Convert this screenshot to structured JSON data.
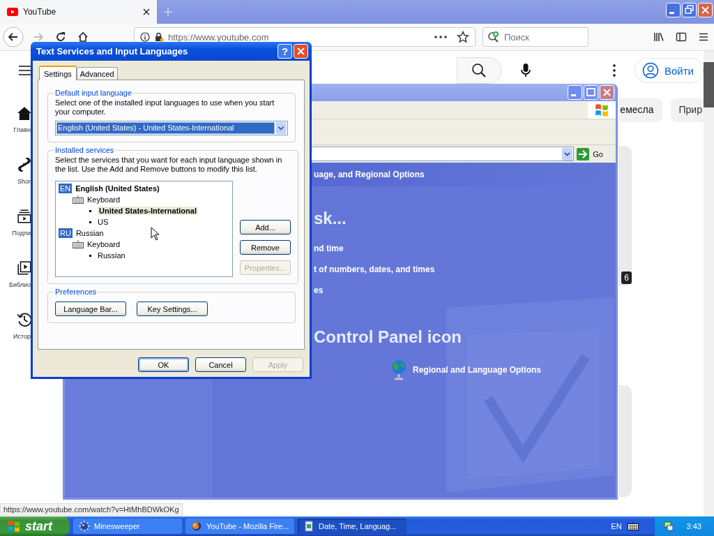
{
  "browser": {
    "tab": {
      "title": "YouTube"
    },
    "url": "https://www.youtube.com",
    "search": {
      "placeholder": "Поиск"
    },
    "status_url": "https://www.youtube.com/watch?v=HtMhBDWkOKg"
  },
  "youtube": {
    "sign_in": "Войти",
    "sidebar": [
      {
        "label": "Главн",
        "kind": "home"
      },
      {
        "label": "Shor",
        "kind": "shorts"
      },
      {
        "label": "Подпи",
        "kind": "subscriptions"
      },
      {
        "label": "Библио",
        "kind": "library"
      },
      {
        "label": "Истор",
        "kind": "history"
      }
    ],
    "chips": [
      {
        "label": "емесла"
      },
      {
        "label": "Прир"
      }
    ],
    "video_duration": "6"
  },
  "control_panel": {
    "go": "Go",
    "header": "uage, and Regional Options",
    "task_heading": "sk...",
    "tasks": [
      "nd time",
      "t of numbers, dates, and times",
      "es"
    ],
    "icon_heading": "Control Panel icon",
    "icons": [
      {
        "label": "Regional and Language Options"
      }
    ]
  },
  "dialog": {
    "title": "Text Services and Input Languages",
    "help": "?",
    "tabs": [
      {
        "label": "Settings",
        "selected": true
      },
      {
        "label": "Advanced",
        "selected": false
      }
    ],
    "default_group": {
      "title": "Default input language",
      "description": "Select one of the installed input languages to use when you start your computer.",
      "value": "English (United States) - United States-International"
    },
    "services_group": {
      "title": "Installed services",
      "description": "Select the services that you want for each input language shown in the list. Use the Add and Remove buttons to modify this list.",
      "languages": [
        {
          "code": "EN",
          "name": "English (United States)",
          "default": true,
          "children": [
            {
              "name": "Keyboard",
              "children": [
                {
                  "name": "United States-International",
                  "default": true,
                  "selected": true
                },
                {
                  "name": "US",
                  "default": false,
                  "selected": false
                }
              ]
            }
          ]
        },
        {
          "code": "RU",
          "name": "Russian",
          "default": false,
          "children": [
            {
              "name": "Keyboard",
              "children": [
                {
                  "name": "Russian",
                  "default": false,
                  "selected": false
                }
              ]
            }
          ]
        }
      ],
      "buttons": [
        {
          "label": "Add...",
          "disabled": false
        },
        {
          "label": "Remove",
          "disabled": false
        },
        {
          "label": "Properties...",
          "disabled": true
        }
      ]
    },
    "preferences_group": {
      "title": "Preferences",
      "buttons": [
        {
          "label": "Language Bar..."
        },
        {
          "label": "Key Settings..."
        }
      ]
    },
    "buttons": [
      {
        "label": "OK",
        "default": true,
        "disabled": false
      },
      {
        "label": "Cancel",
        "default": false,
        "disabled": false
      },
      {
        "label": "Apply",
        "default": false,
        "disabled": true
      }
    ]
  },
  "taskbar": {
    "start": "start",
    "tasks": [
      {
        "label": "Minesweeper",
        "kind": "minesweeper",
        "selected": false
      },
      {
        "label": "YouTube - Mozilla Fire...",
        "kind": "firefox",
        "selected": false
      },
      {
        "label": "Date, Time, Languag...",
        "kind": "control-panel",
        "selected": true
      }
    ],
    "language": "EN",
    "clock": "3:43"
  }
}
